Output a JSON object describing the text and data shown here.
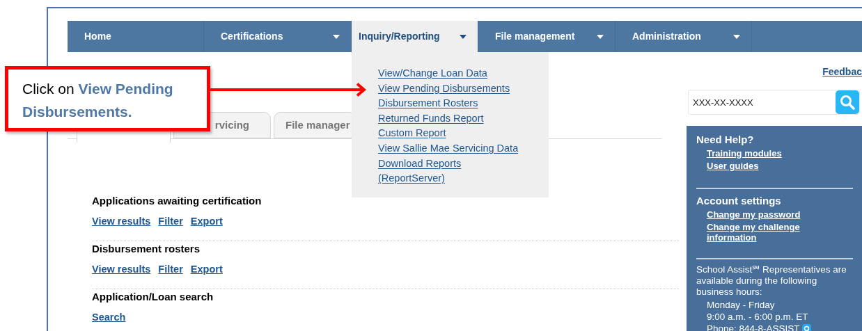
{
  "nav": [
    {
      "label": "Home",
      "has_menu": false,
      "selected": false
    },
    {
      "label": "Certifications",
      "has_menu": true,
      "selected": false
    },
    {
      "label": "Inquiry/Reporting",
      "has_menu": true,
      "selected": true
    },
    {
      "label": "File management",
      "has_menu": true,
      "selected": false
    },
    {
      "label": "Administration",
      "has_menu": true,
      "selected": false
    }
  ],
  "dropdown": {
    "items": [
      "View/Change Loan Data",
      "View Pending Disbursements",
      "Disbursement Rosters",
      "Returned Funds Report",
      "Custom Report",
      "View Sallie Mae Servicing Data",
      "Download Reports (ReportServer)"
    ]
  },
  "callout": {
    "text": "Click on **View Pending Disbursements.**"
  },
  "tabs": [
    {
      "selected": true
    },
    {
      "label": "rvicing",
      "selected": false
    },
    {
      "label": "File manager",
      "selected": false
    }
  ],
  "sections": [
    {
      "title": "Applications awaiting certification",
      "links": [
        "View results",
        "Filter",
        "Export"
      ]
    },
    {
      "title": "Disbursement rosters",
      "links": [
        "View results",
        "Filter",
        "Export"
      ]
    },
    {
      "title": "Application/Loan search",
      "links": [
        "Search"
      ]
    }
  ],
  "sidebar": {
    "feedback": "Feedbac",
    "search": {
      "placeholder": "XXX-XX-XXXX"
    },
    "groups": [
      {
        "title": "Need Help?",
        "links": [
          "Training modules",
          "User guides"
        ]
      },
      {
        "title": "Account settings",
        "links": [
          "Change my password",
          "Change my challenge information"
        ]
      }
    ],
    "hours": {
      "intro": "School Assist℠ Representatives are available during the following business hours:",
      "lines": [
        "Monday - Friday",
        "9:00 a.m. - 6:00 p.m. ET",
        "Phone: 844-8-ASSIST"
      ]
    }
  }
}
